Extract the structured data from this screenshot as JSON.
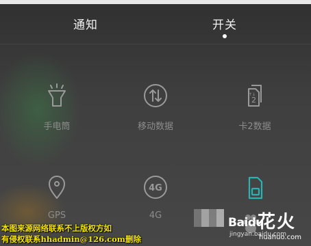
{
  "tabs": {
    "notify_label": "通知",
    "switch_label": "开关",
    "active": "开关"
  },
  "toggles": [
    {
      "label": "手电筒",
      "icon": "flashlight-icon"
    },
    {
      "label": "移动数据",
      "icon": "mobile-data-icon"
    },
    {
      "label": "卡2数据",
      "icon": "sim2-data-icon"
    },
    {
      "label": "GPS",
      "icon": "location-pin-icon"
    },
    {
      "label": "4G",
      "icon": "4g-icon"
    },
    {
      "label": "",
      "icon": "sim-card-icon"
    }
  ],
  "colors": {
    "tile_icon": "#9a9a9a",
    "tile_label": "#8c8c8c",
    "active_accent": "#2ab3b3",
    "watermark_text": "#f5e600"
  },
  "watermarks": {
    "line1": "本图来源网络联系不上版权方如",
    "line2": "有侵权联系hhadmin@126.com删除",
    "baidu": "Baidu",
    "jingyan": "jingyan.baidu.com",
    "huahuo_cn": "花火",
    "huahuo_en": "huahuo.com"
  }
}
